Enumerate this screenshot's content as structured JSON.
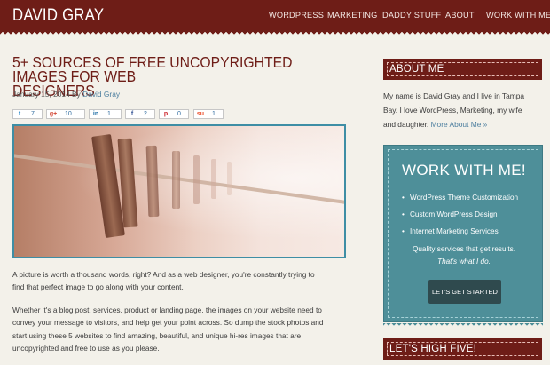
{
  "header": {
    "brand": "DAVID GRAY",
    "nav": [
      "WORDPRESS",
      "MARKETING",
      "DADDY STUFF",
      "ABOUT",
      "WORK WITH ME"
    ]
  },
  "post": {
    "title_line1": "5+ SOURCES OF FREE UNCOPYRIGHTED IMAGES FOR WEB",
    "title_line2": "DESIGNERS",
    "date": "January 15, 2014 By",
    "author": "David Gray",
    "share": [
      {
        "icon": "twitter-icon",
        "symbol": "t",
        "count": "7"
      },
      {
        "icon": "google-plus-icon",
        "symbol": "g+",
        "count": "10"
      },
      {
        "icon": "linkedin-icon",
        "symbol": "in",
        "count": "1"
      },
      {
        "icon": "facebook-icon",
        "symbol": "f",
        "count": "2"
      },
      {
        "icon": "pinterest-icon",
        "symbol": "p",
        "count": "0"
      },
      {
        "icon": "stumbleupon-icon",
        "symbol": "su",
        "count": "1"
      }
    ],
    "p1_line1": "A picture is worth a thousand words, right? And as a web designer, you're constantly trying to",
    "p1_line2": "find that perfect image to go along with your content.",
    "p2_line1": "Whether it's a blog post, services, product or landing page, the images on your website need to",
    "p2_line2": "convey your message to visitors, and help get your point across. So dump the stock photos and",
    "p2_line3": "start using these 5 websites to find amazing, beautiful, and unique hi-res images that are",
    "p2_line4": "uncopyrighted and free to use as you please."
  },
  "sidebar": {
    "about_title": "ABOUT ME",
    "about_line1": "My name is David Gray and I live in Tampa",
    "about_line2": "Bay. I love WordPress, Marketing, my wife",
    "about_line3": "and daughter.",
    "about_more": "More About Me »",
    "cta_title": "WORK WITH ME!",
    "cta_items": [
      "WordPress Theme Customization",
      "Custom WordPress Design",
      "Internet Marketing Services"
    ],
    "cta_tag1": "Quality services that get results.",
    "cta_tag2": "That's what I do.",
    "cta_button": "LET'S GET STARTED",
    "high_five_title": "LET'S HIGH FIVE!"
  },
  "colors": {
    "brand": "#6e1d17",
    "teal": "#4e8f99",
    "link": "#4d7f9f"
  }
}
